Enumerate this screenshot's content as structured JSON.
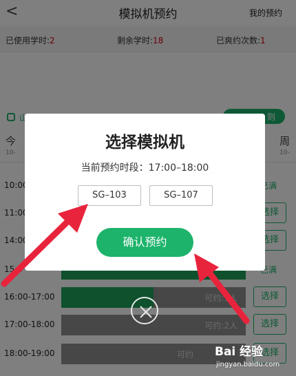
{
  "header": {
    "back": "<",
    "title": "模拟机预约",
    "my_reservations": "我的预约"
  },
  "stats": {
    "used_label": "已使用学时:",
    "used_value": "2",
    "remaining_label": "剩余学时:",
    "remaining_value": "18",
    "missed_label": "已爽约次数:",
    "missed_value": "1"
  },
  "info": {
    "phone_text": "山",
    "rules_button": "则"
  },
  "days": [
    {
      "name": "今",
      "date": "10-"
    },
    {
      "name": "周",
      "date": "10-"
    }
  ],
  "slots": [
    {
      "time": "10:00",
      "status": "已满",
      "fill": 1.0
    },
    {
      "time": "11:00",
      "action": "选择",
      "fill": 1.0
    },
    {
      "time": "14:00",
      "action": "选择",
      "fill": 1.0
    },
    {
      "time": "15:0",
      "status": "已满",
      "fill": 1.0
    },
    {
      "time": "16:00-17:00",
      "bar_text": "可约:1人",
      "action": "选择",
      "fill": 0.5
    },
    {
      "time": "17:00-18:00",
      "bar_text": "可约:2人",
      "action": "选择",
      "fill": 0.0
    },
    {
      "time": "18:00-19:00",
      "bar_text": "可约",
      "action": "选择",
      "fill": 0.0
    }
  ],
  "dialog": {
    "title": "选择模拟机",
    "subtitle": "当前预约时段：17:00–18:00",
    "simulators": [
      "SG–103",
      "SG–107"
    ],
    "confirm": "确认预约"
  },
  "watermark": {
    "logo": "Bai 经验",
    "url": "jingyan.baidu.com"
  },
  "colors": {
    "accent": "#1db36b",
    "warning": "#d0021b",
    "arrow": "#e8243c"
  }
}
